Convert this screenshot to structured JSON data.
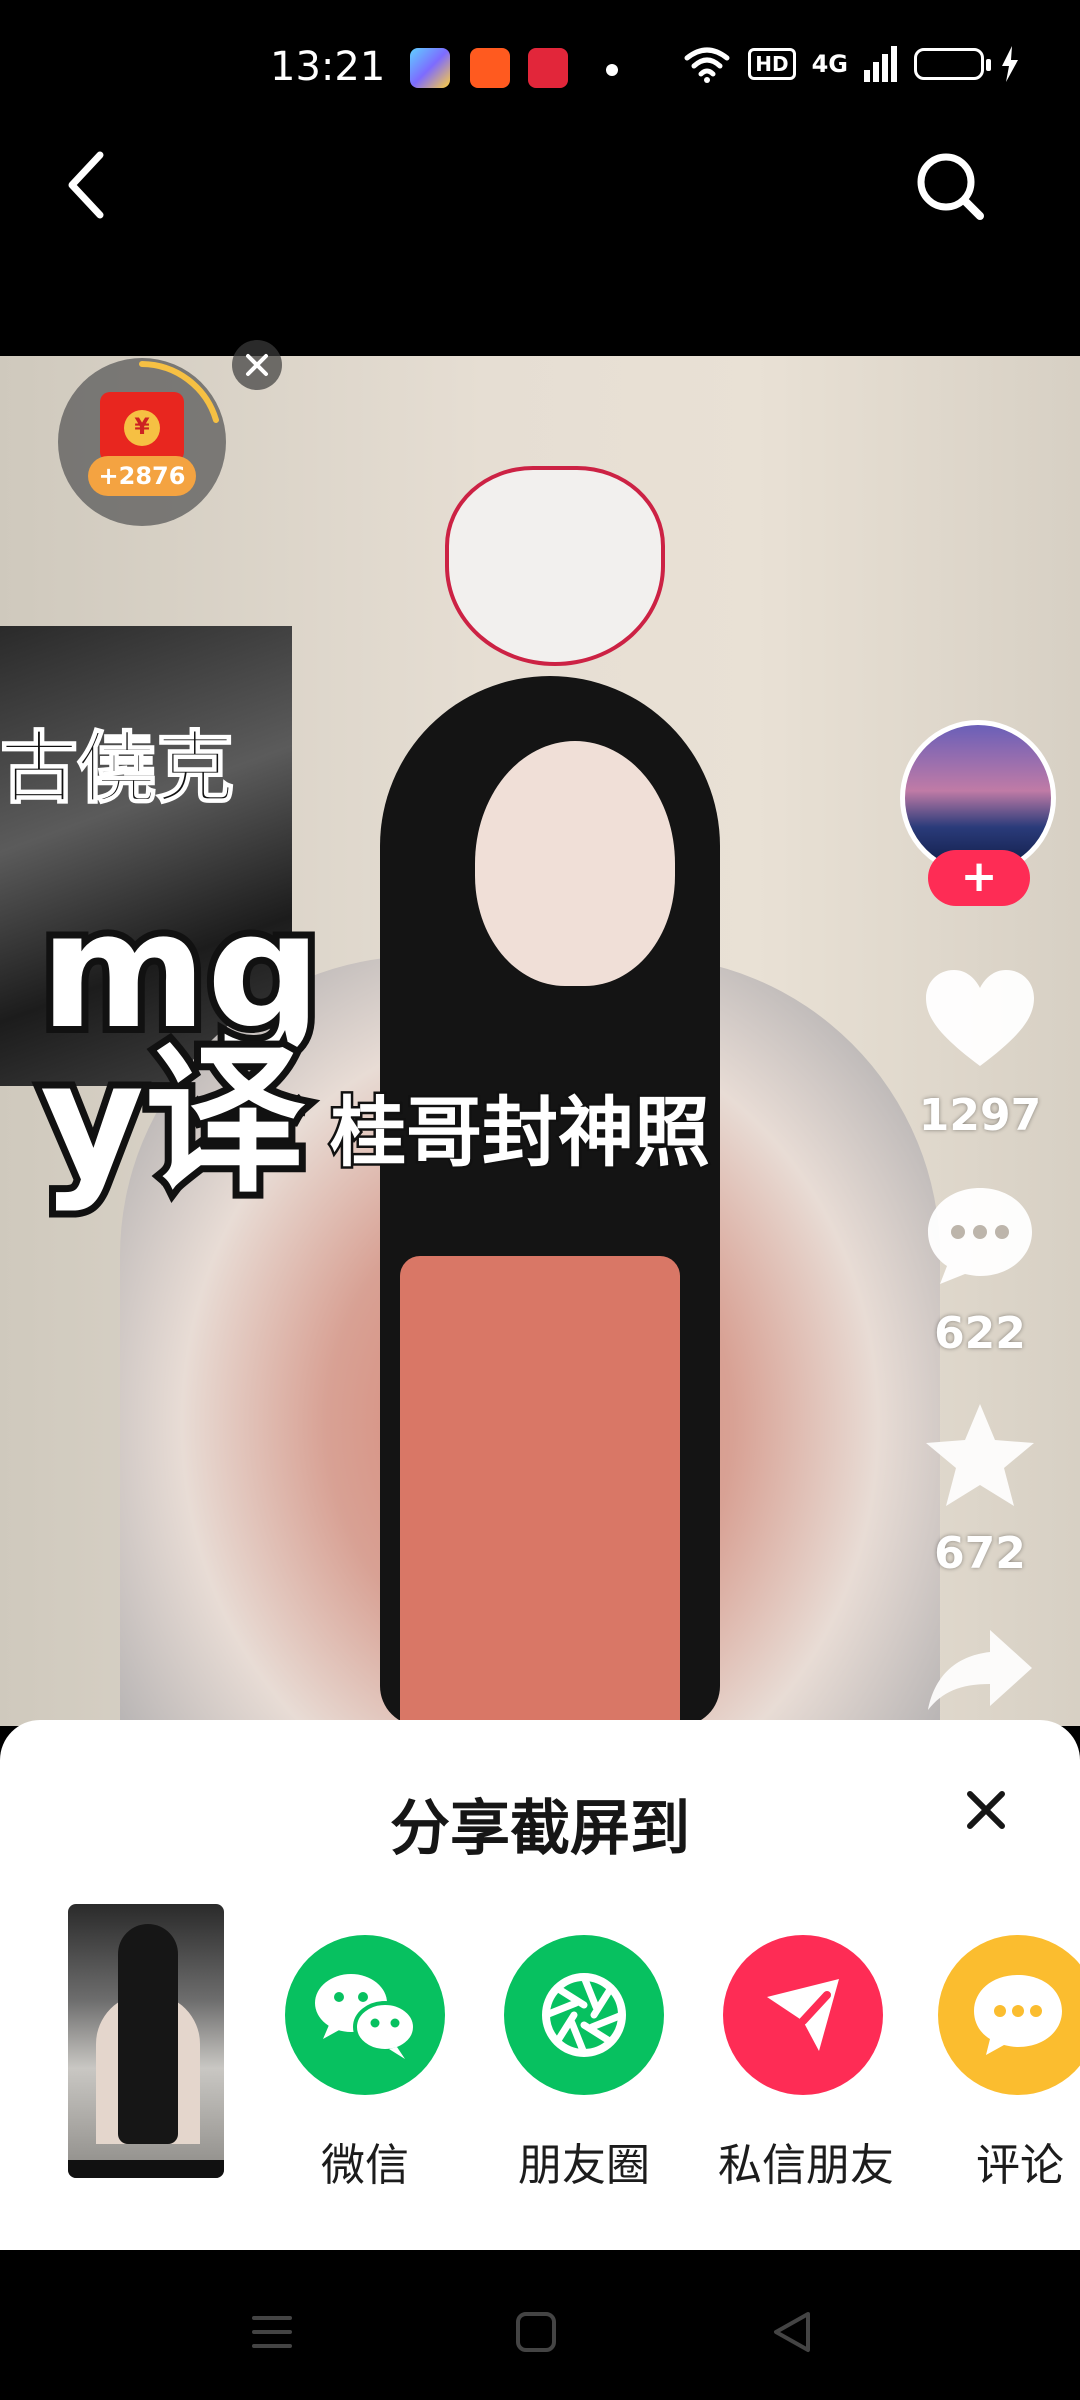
{
  "status_bar": {
    "time": "13:21",
    "hd_label": "HD",
    "network_label": "4G",
    "app_icons": [
      {
        "icon": "gallery-app-icon",
        "color": "#4c8ef7"
      },
      {
        "icon": "orange-app-icon",
        "color": "#ff5a1f"
      },
      {
        "icon": "shopping-app-icon",
        "color": "#e2263a"
      }
    ]
  },
  "nav": {
    "back_icon": "chevron-left-icon",
    "search_icon": "search-icon"
  },
  "video": {
    "overlay_text_1": "mg",
    "overlay_text_2": "y译",
    "poster_text": "古僥克",
    "caption": "桂哥封神照"
  },
  "reward": {
    "amount": "+2876",
    "close_icon": "close-icon",
    "coin_symbol": "¥"
  },
  "actions": {
    "follow_symbol": "+",
    "like_count": "1297",
    "comment_count": "622",
    "favorite_count": "672"
  },
  "share_sheet": {
    "title": "分享截屏到",
    "close_icon": "close-icon",
    "targets": [
      {
        "label": "微信",
        "color": "#07c160",
        "icon": "wechat-icon"
      },
      {
        "label": "朋友圈",
        "color": "#07c160",
        "icon": "moments-icon"
      },
      {
        "label": "私信朋友",
        "color": "#fe2c55",
        "icon": "send-icon"
      },
      {
        "label": "评论",
        "color": "#fbbd2f",
        "icon": "comment-icon"
      }
    ]
  },
  "colors": {
    "accent": "#fe2c55",
    "wechat_green": "#07c160",
    "comment_yellow": "#fbbd2f"
  }
}
